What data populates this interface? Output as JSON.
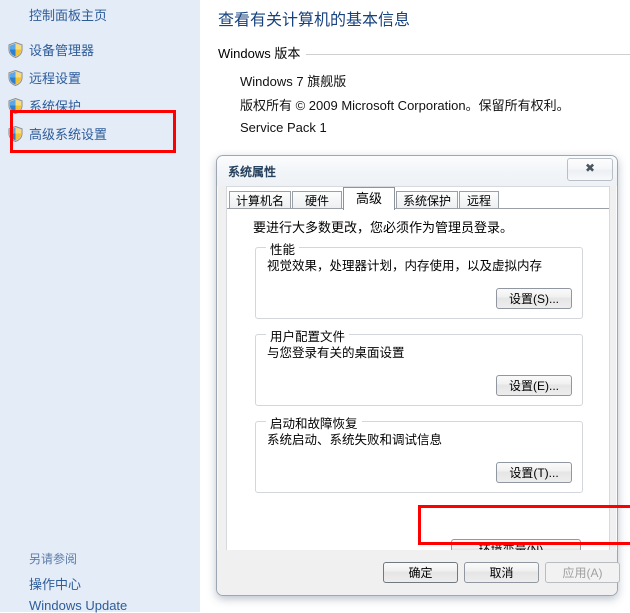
{
  "sidebar": {
    "home_label": "控制面板主页",
    "items": [
      {
        "label": "设备管理器",
        "icon": "shield-icon"
      },
      {
        "label": "远程设置",
        "icon": "shield-icon"
      },
      {
        "label": "系统保护",
        "icon": "shield-icon"
      },
      {
        "label": "高级系统设置",
        "icon": "shield-icon"
      }
    ],
    "see_also": {
      "title": "另请参阅",
      "links": [
        "操作中心",
        "Windows Update"
      ]
    }
  },
  "content": {
    "page_title": "查看有关计算机的基本信息",
    "section_label": "Windows 版本",
    "lines": [
      "Windows 7 旗舰版",
      "版权所有 © 2009 Microsoft Corporation。保留所有权利。",
      "Service Pack 1"
    ]
  },
  "dialog": {
    "title": "系统属性",
    "close_glyph": "✖",
    "tabs": [
      {
        "label": "计算机名",
        "selected": false
      },
      {
        "label": "硬件",
        "selected": false
      },
      {
        "label": "高级",
        "selected": true
      },
      {
        "label": "系统保护",
        "selected": false
      },
      {
        "label": "远程",
        "selected": false
      }
    ],
    "intro": "要进行大多数更改，您必须作为管理员登录。",
    "groups": [
      {
        "legend": "性能",
        "description": "视觉效果，处理器计划，内存使用，以及虚拟内存",
        "button": "设置(S)..."
      },
      {
        "legend": "用户配置文件",
        "description": "与您登录有关的桌面设置",
        "button": "设置(E)..."
      },
      {
        "legend": "启动和故障恢复",
        "description": "系统启动、系统失败和调试信息",
        "button": "设置(T)..."
      }
    ],
    "env_button": "环境变量(N)...",
    "footer": {
      "ok": "确定",
      "cancel": "取消",
      "apply": "应用(A)",
      "apply_disabled": true
    }
  },
  "annotations": {
    "accent_color": "#ff0000",
    "boxes": [
      "高级系统设置",
      "环境变量(N)..."
    ]
  }
}
